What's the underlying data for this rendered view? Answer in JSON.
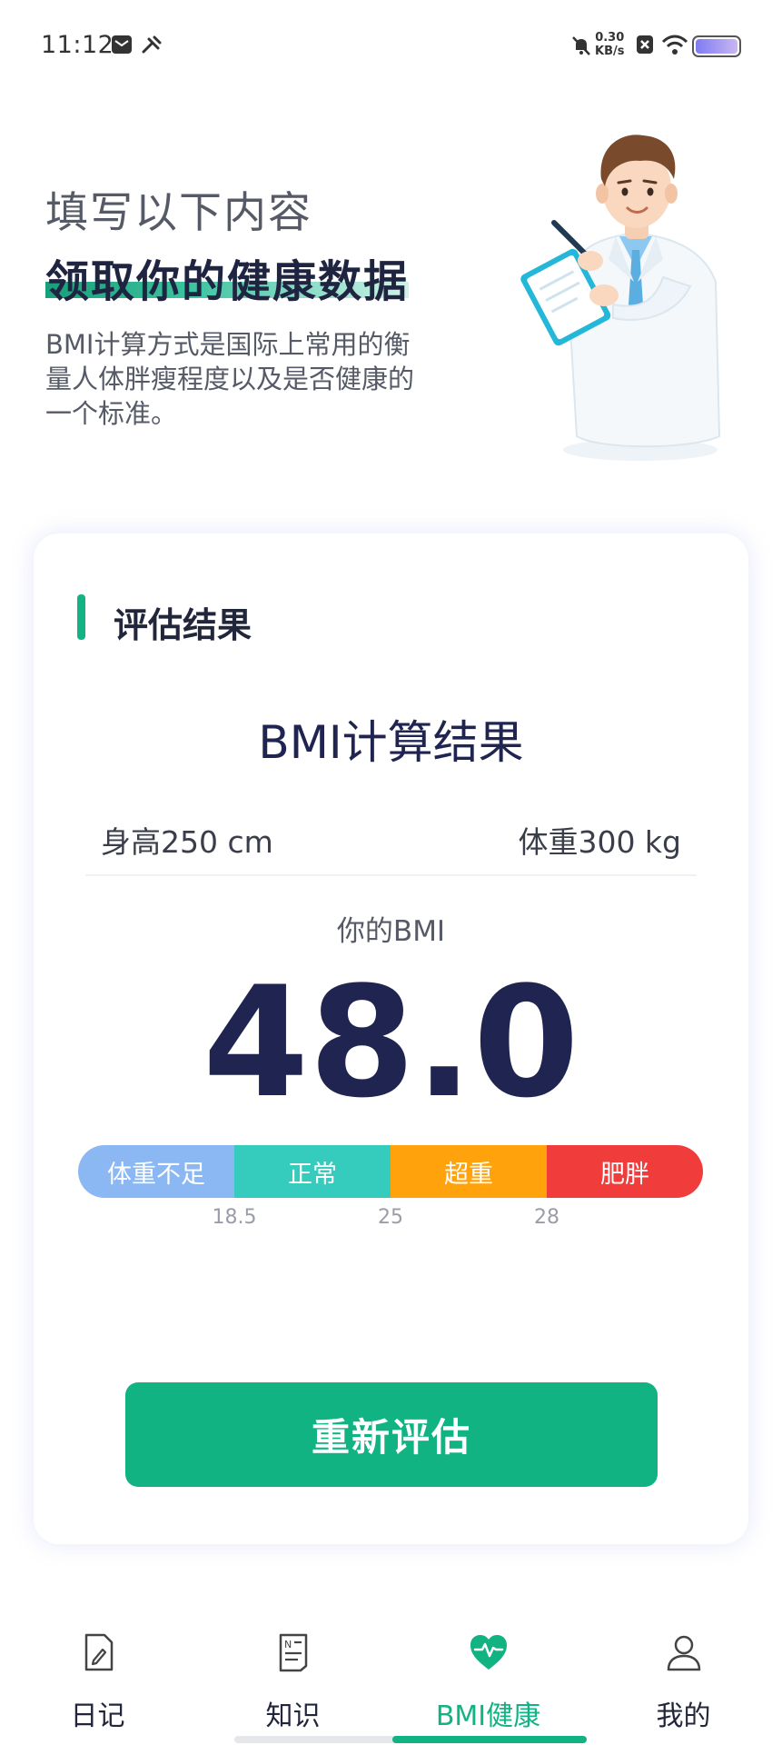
{
  "status_bar": {
    "time": "11:12",
    "net_speed_value": "0.30",
    "net_speed_unit": "KB/s",
    "icons": [
      "mail-icon",
      "tools-icon",
      "mute-bell-icon",
      "no-sim-icon",
      "wifi-icon",
      "battery-icon"
    ]
  },
  "hero": {
    "line1": "填写以下内容",
    "line2": "领取你的健康数据",
    "description": "BMI计算方式是国际上常用的衡量人体胖瘦程度以及是否健康的一个标准。"
  },
  "card": {
    "title": "评估结果",
    "bmi_heading": "BMI计算结果",
    "height": "身高250 cm",
    "weight": "体重300 kg",
    "your_bmi_label": "你的BMI",
    "bmi_value": "48.0",
    "scale": {
      "segments": [
        "体重不足",
        "正常",
        "超重",
        "肥胖"
      ],
      "segment_colors": [
        "#8bb8f2",
        "#35cbbd",
        "#ffa20b",
        "#f13c3c"
      ],
      "ticks": [
        "18.5",
        "25",
        "28"
      ]
    },
    "button_label": "重新评估"
  },
  "nav": {
    "items": [
      {
        "label": "日记",
        "icon": "diary-icon",
        "active": false
      },
      {
        "label": "知识",
        "icon": "knowledge-icon",
        "active": false
      },
      {
        "label": "BMI健康",
        "icon": "heart-pulse-icon",
        "active": true
      },
      {
        "label": "我的",
        "icon": "profile-icon",
        "active": false
      }
    ]
  },
  "colors": {
    "accent": "#12b383",
    "dark_text": "#1f2550"
  }
}
